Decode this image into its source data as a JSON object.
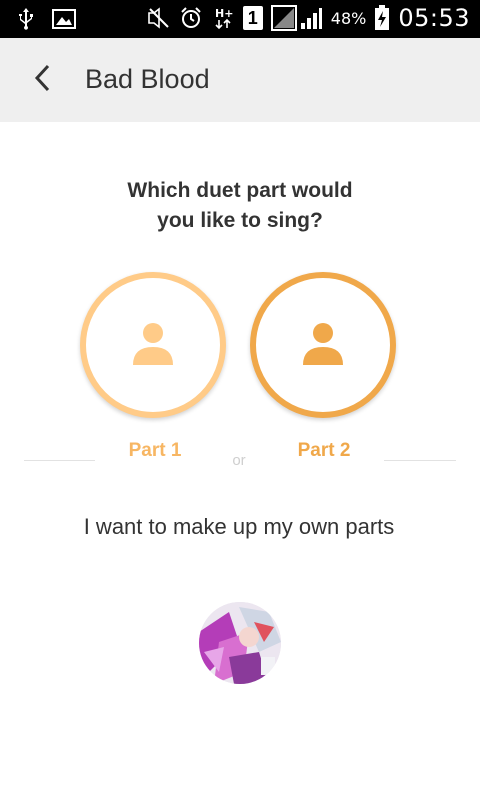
{
  "status_bar": {
    "battery": "48%",
    "time": "05:53",
    "sim": "1",
    "icons": [
      "usb-icon",
      "image-icon",
      "mute-icon",
      "alarm-icon",
      "hplus-icon",
      "sim-icon",
      "signal-icon",
      "battery-icon"
    ]
  },
  "app_bar": {
    "title": "Bad Blood",
    "back_icon": "chevron-left-icon"
  },
  "main": {
    "prompt": "Which duet part would you like to sing?",
    "parts": [
      {
        "label": "Part 1",
        "icon": "person-icon",
        "color": "#ffcb88"
      },
      {
        "label": "Part 2",
        "icon": "person-icon",
        "color": "#f0a84a"
      }
    ],
    "or_text": "or",
    "own_parts": "I want to make up my own parts"
  },
  "colors": {
    "part1": "#ffcb88",
    "part2": "#f0a84a",
    "text": "#333333",
    "app_bar_bg": "#efefef"
  }
}
